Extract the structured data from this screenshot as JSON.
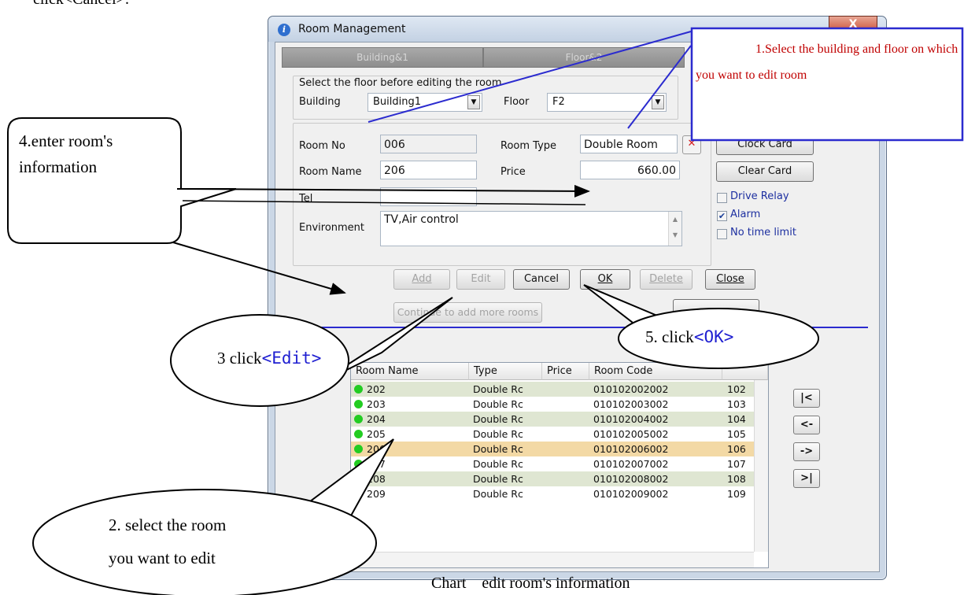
{
  "top_text": "click<Cancel>.",
  "caption": "Chart    edit room's information",
  "window": {
    "title": "Room Management",
    "close_glyph": "X",
    "tabs": [
      "Building&1",
      "Floor&2"
    ],
    "floor_group_label": "Select the floor before editing the room",
    "building_label": "Building",
    "building_value": "Building1",
    "floor_label": "Floor",
    "floor_value": "F2"
  },
  "room_form": {
    "room_no_label": "Room No",
    "room_no_value": "006",
    "room_type_label": "Room Type",
    "room_type_value": "Double Room",
    "room_name_label": "Room Name",
    "room_name_value": "206",
    "price_label": "Price",
    "price_value": "660.00",
    "tel_label": "Tel",
    "tel_value": "",
    "environment_label": "Environment",
    "environment_value": "TV,Air control"
  },
  "card_buttons": {
    "clock_card": "Clock Card",
    "clear_card": "Clear Card"
  },
  "options": [
    {
      "label": "Drive Relay",
      "checked": false
    },
    {
      "label": "Alarm",
      "checked": true
    },
    {
      "label": "No time limit",
      "checked": false
    }
  ],
  "actions": {
    "add": "Add",
    "edit": "Edit",
    "cancel": "Cancel",
    "ok": "OK",
    "delete": "Delete",
    "close": "Close",
    "add_more": "Continue to add more rooms"
  },
  "grid": {
    "columns": [
      "Room Name",
      "Type",
      "Price",
      "Room Code",
      ""
    ],
    "rows": [
      {
        "name": "202",
        "type": "Double Rc",
        "price": "",
        "code": "010102002002",
        "num": "102",
        "selected": false
      },
      {
        "name": "203",
        "type": "Double Rc",
        "price": "",
        "code": "010102003002",
        "num": "103",
        "selected": false
      },
      {
        "name": "204",
        "type": "Double Rc",
        "price": "",
        "code": "010102004002",
        "num": "104",
        "selected": false
      },
      {
        "name": "205",
        "type": "Double Rc",
        "price": "",
        "code": "010102005002",
        "num": "105",
        "selected": false
      },
      {
        "name": "206",
        "type": "Double Rc",
        "price": "",
        "code": "010102006002",
        "num": "106",
        "selected": true
      },
      {
        "name": "207",
        "type": "Double Rc",
        "price": "",
        "code": "010102007002",
        "num": "107",
        "selected": false
      },
      {
        "name": "208",
        "type": "Double Rc",
        "price": "",
        "code": "010102008002",
        "num": "108",
        "selected": false
      },
      {
        "name": "209",
        "type": "Double Rc",
        "price": "",
        "code": "010102009002",
        "num": "109",
        "selected": false
      }
    ]
  },
  "nav_buttons": [
    "|<",
    "<-",
    "->",
    ">|"
  ],
  "callouts": {
    "step1": "1.Select the building and floor on which you want to edit room",
    "step2_line1": "2. select the room",
    "step2_line2": "you want to edit",
    "step3_prefix": "3 click",
    "step3_button": "<Edit>",
    "step4": "4.enter room's information",
    "step5_prefix": "5. click",
    "step5_button": "<OK>"
  },
  "colors": {
    "callout_red": "#c00000",
    "callout_blue": "#1f1fd1",
    "arrow_blue": "#2b2bcf",
    "selected_row": "#f3d9a5",
    "alt_row": "#dfe6d2",
    "status_dot": "#22cc22"
  }
}
